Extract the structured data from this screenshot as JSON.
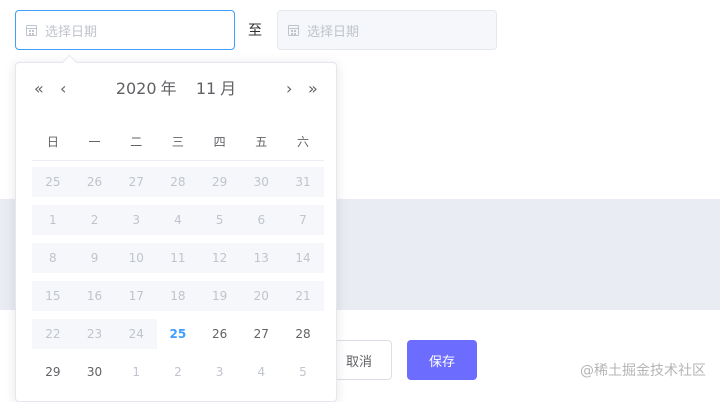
{
  "range_picker": {
    "start_placeholder": "选择日期",
    "end_placeholder": "选择日期",
    "separator": "至"
  },
  "calendar": {
    "year": "2020",
    "year_suffix": "年",
    "month": "11",
    "month_suffix": "月",
    "nav": {
      "prev_year": "«",
      "prev_month": "‹",
      "next_month": "›",
      "next_year": "»"
    },
    "weekdays": [
      "日",
      "一",
      "二",
      "三",
      "四",
      "五",
      "六"
    ],
    "weeks": [
      [
        {
          "d": "25",
          "s": "disabled"
        },
        {
          "d": "26",
          "s": "disabled"
        },
        {
          "d": "27",
          "s": "disabled"
        },
        {
          "d": "28",
          "s": "disabled"
        },
        {
          "d": "29",
          "s": "disabled"
        },
        {
          "d": "30",
          "s": "disabled"
        },
        {
          "d": "31",
          "s": "disabled"
        }
      ],
      [
        {
          "d": "1",
          "s": "disabled"
        },
        {
          "d": "2",
          "s": "disabled"
        },
        {
          "d": "3",
          "s": "disabled"
        },
        {
          "d": "4",
          "s": "disabled"
        },
        {
          "d": "5",
          "s": "disabled"
        },
        {
          "d": "6",
          "s": "disabled"
        },
        {
          "d": "7",
          "s": "disabled"
        }
      ],
      [
        {
          "d": "8",
          "s": "disabled"
        },
        {
          "d": "9",
          "s": "disabled"
        },
        {
          "d": "10",
          "s": "disabled"
        },
        {
          "d": "11",
          "s": "disabled"
        },
        {
          "d": "12",
          "s": "disabled"
        },
        {
          "d": "13",
          "s": "disabled"
        },
        {
          "d": "14",
          "s": "disabled"
        }
      ],
      [
        {
          "d": "15",
          "s": "disabled"
        },
        {
          "d": "16",
          "s": "disabled"
        },
        {
          "d": "17",
          "s": "disabled"
        },
        {
          "d": "18",
          "s": "disabled"
        },
        {
          "d": "19",
          "s": "disabled"
        },
        {
          "d": "20",
          "s": "disabled"
        },
        {
          "d": "21",
          "s": "disabled"
        }
      ],
      [
        {
          "d": "22",
          "s": "disabled"
        },
        {
          "d": "23",
          "s": "disabled"
        },
        {
          "d": "24",
          "s": "disabled"
        },
        {
          "d": "25",
          "s": "today"
        },
        {
          "d": "26",
          "s": "normal"
        },
        {
          "d": "27",
          "s": "normal"
        },
        {
          "d": "28",
          "s": "normal"
        }
      ],
      [
        {
          "d": "29",
          "s": "normal"
        },
        {
          "d": "30",
          "s": "normal"
        },
        {
          "d": "1",
          "s": "other"
        },
        {
          "d": "2",
          "s": "other"
        },
        {
          "d": "3",
          "s": "other"
        },
        {
          "d": "4",
          "s": "other"
        },
        {
          "d": "5",
          "s": "other"
        }
      ]
    ]
  },
  "actions": {
    "cancel_label": "取消",
    "save_label": "保存"
  },
  "watermark": "@稀土掘金技术社区",
  "colors": {
    "accent": "#409eff",
    "save_button": "#6c6cff",
    "disabled_bg": "#f5f7fa"
  }
}
